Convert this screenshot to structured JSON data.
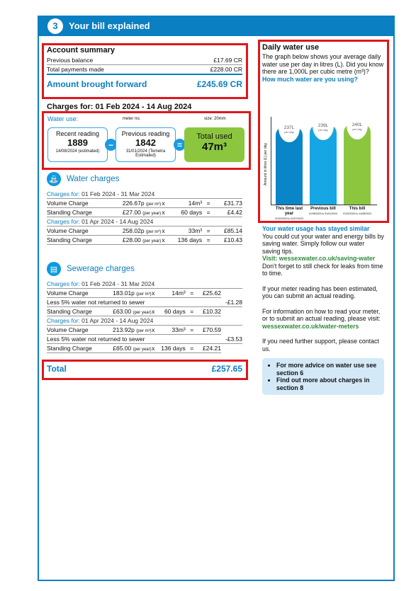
{
  "header": {
    "number": "3",
    "title": "Your bill explained"
  },
  "account": {
    "title": "Account summary",
    "rows": [
      {
        "label": "Previous balance",
        "value": "£17.69 CR"
      },
      {
        "label": "Total payments made",
        "value": "£228.00 CR"
      }
    ],
    "forward_label": "Amount brought forward",
    "forward_value": "£245.69 CR"
  },
  "charges_title": "Charges for: 01 Feb 2024 - 14 Aug 2024",
  "water_use": {
    "label": "Water use:",
    "meter_label": "meter no.",
    "size_label": "size: 20mm",
    "recent": {
      "title": "Recent reading",
      "value": "1889",
      "date": "14/08/2024 (estimated)"
    },
    "previous": {
      "title": "Previous reading",
      "value": "1842",
      "date": "31/01/2024 (Temetra Estimated)"
    },
    "minus": "−",
    "equals": "=",
    "total_title": "Total used",
    "total_value": "47m³"
  },
  "water": {
    "title": "Water charges",
    "periods": [
      {
        "label": "Charges for:",
        "dates": "01 Feb 2024 - 31 Mar 2024",
        "rows": [
          {
            "name": "Volume Charge",
            "rate": "226.67p",
            "unit": "(per m³)",
            "x": "x",
            "qty": "14m³",
            "eq": "=",
            "amount": "£31.73"
          },
          {
            "name": "Standing Charge",
            "rate": "£27.00",
            "unit": "(per year)",
            "x": "x",
            "qty": "60 days",
            "eq": "=",
            "amount": "£4.42"
          }
        ]
      },
      {
        "label": "Charges for:",
        "dates": "01 Apr 2024 - 14 Aug 2024",
        "rows": [
          {
            "name": "Volume Charge",
            "rate": "258.02p",
            "unit": "(per m³)",
            "x": "x",
            "qty": "33m³",
            "eq": "=",
            "amount": "£85.14"
          },
          {
            "name": "Standing Charge",
            "rate": "£28.00",
            "unit": "(per year)",
            "x": "x",
            "qty": "136 days",
            "eq": "=",
            "amount": "£10.43"
          }
        ]
      }
    ]
  },
  "sewerage": {
    "title": "Sewerage charges",
    "periods": [
      {
        "label": "Charges for:",
        "dates": "01 Feb 2024 - 31 Mar 2024",
        "rows": [
          {
            "name": "Volume Charge",
            "rate": "183.01p",
            "unit": "(per m³)",
            "x": "x",
            "qty": "14m³",
            "eq": "=",
            "amount": "£25.62"
          },
          {
            "name": "Less 5% water not returned to sewer",
            "amount": "-£1.28"
          },
          {
            "name": "Standing Charge",
            "rate": "£63.00",
            "unit": "(per year)",
            "x": "x",
            "qty": "60 days",
            "eq": "=",
            "amount": "£10.32"
          }
        ]
      },
      {
        "label": "Charges for:",
        "dates": "01 Apr 2024 - 14 Aug 2024",
        "rows": [
          {
            "name": "Volume Charge",
            "rate": "213.92p",
            "unit": "(per m³)",
            "x": "x",
            "qty": "33m³",
            "eq": "=",
            "amount": "£70.59"
          },
          {
            "name": "Less 5% water not returned to sewer",
            "amount": "-£3.53"
          },
          {
            "name": "Standing Charge",
            "rate": "£65.00",
            "unit": "(per year)",
            "x": "x",
            "qty": "136 days",
            "eq": "=",
            "amount": "£24.21"
          }
        ]
      }
    ]
  },
  "total": {
    "label": "Total",
    "value": "£257.65"
  },
  "daily": {
    "title": "Daily water use",
    "intro": "The graph below shows your average daily water use per day in litres (L). Did you know there are 1,000L per cubic metre (m³)?",
    "question": "How much water are you using?",
    "ylabel": "Amount in litres (L) per day",
    "bars": [
      {
        "value": "237L",
        "per": "per day",
        "label": "This time last year",
        "dates": "01/02/2023 to 31/07/2023",
        "color": "#0a86c8"
      },
      {
        "value": "239L",
        "per": "per day",
        "label": "Previous bill",
        "dates": "01/08/2023 to 31/01/2024",
        "color": "#16a6e3"
      },
      {
        "value": "240L",
        "per": "per day",
        "label": "This bill",
        "dates": "01/02/2024 to 14/08/2024",
        "color": "#8cc63f"
      }
    ]
  },
  "info": {
    "similar": "Your water usage has stayed similar",
    "p1": "You could cut your water and energy bills by saving water. Simply follow our water saving tips.",
    "visit": "Visit: wessexwater.co.uk/saving-water",
    "p1b": "Don't forget to still check for leaks from time to time.",
    "p2": "If your meter reading has been estimated, you can submit an actual reading.",
    "p3": "For information on how to read your meter, or to submit an actual reading, please visit:",
    "link3": "wessexwater.co.uk/water-meters",
    "p4": "If you need further support, please contact us.",
    "bullets": [
      "For more advice on water use see section 6",
      "Find out more about charges in section 8"
    ]
  },
  "colors": {
    "brand": "#0a7fc2",
    "highlight": "#e0161c",
    "green": "#8cc63f"
  }
}
